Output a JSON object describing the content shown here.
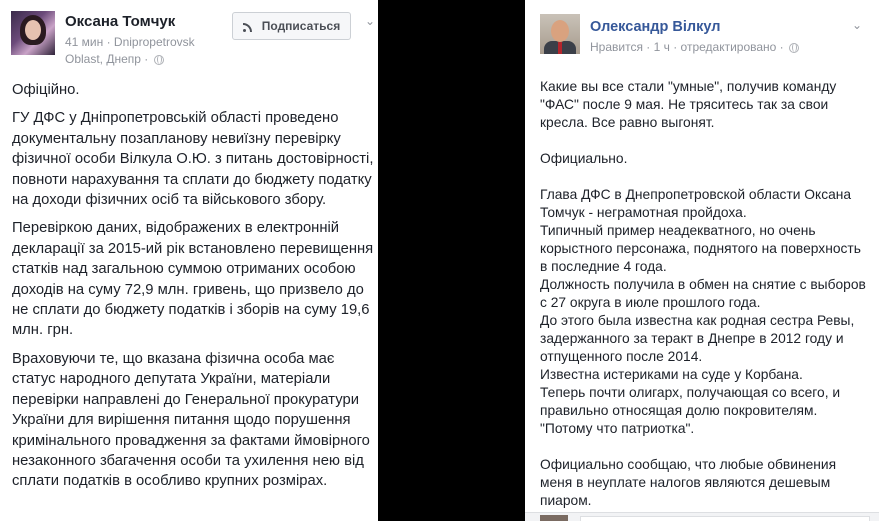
{
  "left_post": {
    "author": "Оксана Томчук",
    "meta": "41 мин · Dnipropetrovsk Oblast, Днепр ·",
    "subscribe_label": "Подписаться",
    "paragraphs": [
      "Офіційно.",
      "ГУ ДФС у Дніпропетровській області проведено документальну позапланову невиїзну перевірку фізичної особи Вілкула О.Ю. з питань достовірності, повноти нарахування та сплати до бюджету податку на доходи фізичних осіб та військового збору.",
      "Перевіркою даних, відображених в електронній декларації за 2015-ий рік встановлено перевищення статків над загальною суммою отриманих особою доходів на суму 72,9 млн. гривень, що призвело до не сплати до бюджету податків і зборів на суму 19,6 млн. грн.",
      "Враховуючи те, що вказана фізична особа має статус народного депутата України, матеріали перевірки направлені до Генеральної прокуратури України для вирішення питання щодо порушення кримінального провадження за фактами ймовірного незаконного збагачення особи та ухилення нею від сплати податків в особливо крупних розмірах."
    ]
  },
  "right_post": {
    "author": "Олександр Вілкул",
    "meta": "Нравится · 1 ч · отредактировано ·",
    "lines": [
      "Какие вы все стали \"умные\", получив команду \"ФАС\" после 9 мая. Не тряситесь так за свои кресла. Все равно выгонят.",
      "",
      "Официально.",
      "",
      "Глава ДФС в Днепропетровской области Оксана Томчук - неграмотная пройдоха.",
      "Типичный пример неадекватного, но очень корыстного персонажа, поднятого на поверхность в последние 4 года.",
      "Должность получила в обмен на снятие с выборов с 27 округа в июле прошлого года.",
      "До этого была известна как родная сестра Ревы, задержанного за теракт в Днепре в 2012 году и отпущенного после 2014.",
      "Известна истериками на суде у Корбана.",
      "Теперь почти олигарх, получающая со всего, и правильно относящая долю покровителям.",
      "\"Потому что патриотка\".",
      "",
      "Официально сообщаю, что любые обвинения меня в неуплате налогов являются дешевым пиаром."
    ]
  },
  "icons": {
    "chevron": "chevron-down-icon",
    "globe": "globe-icon",
    "rss": "rss-icon"
  }
}
